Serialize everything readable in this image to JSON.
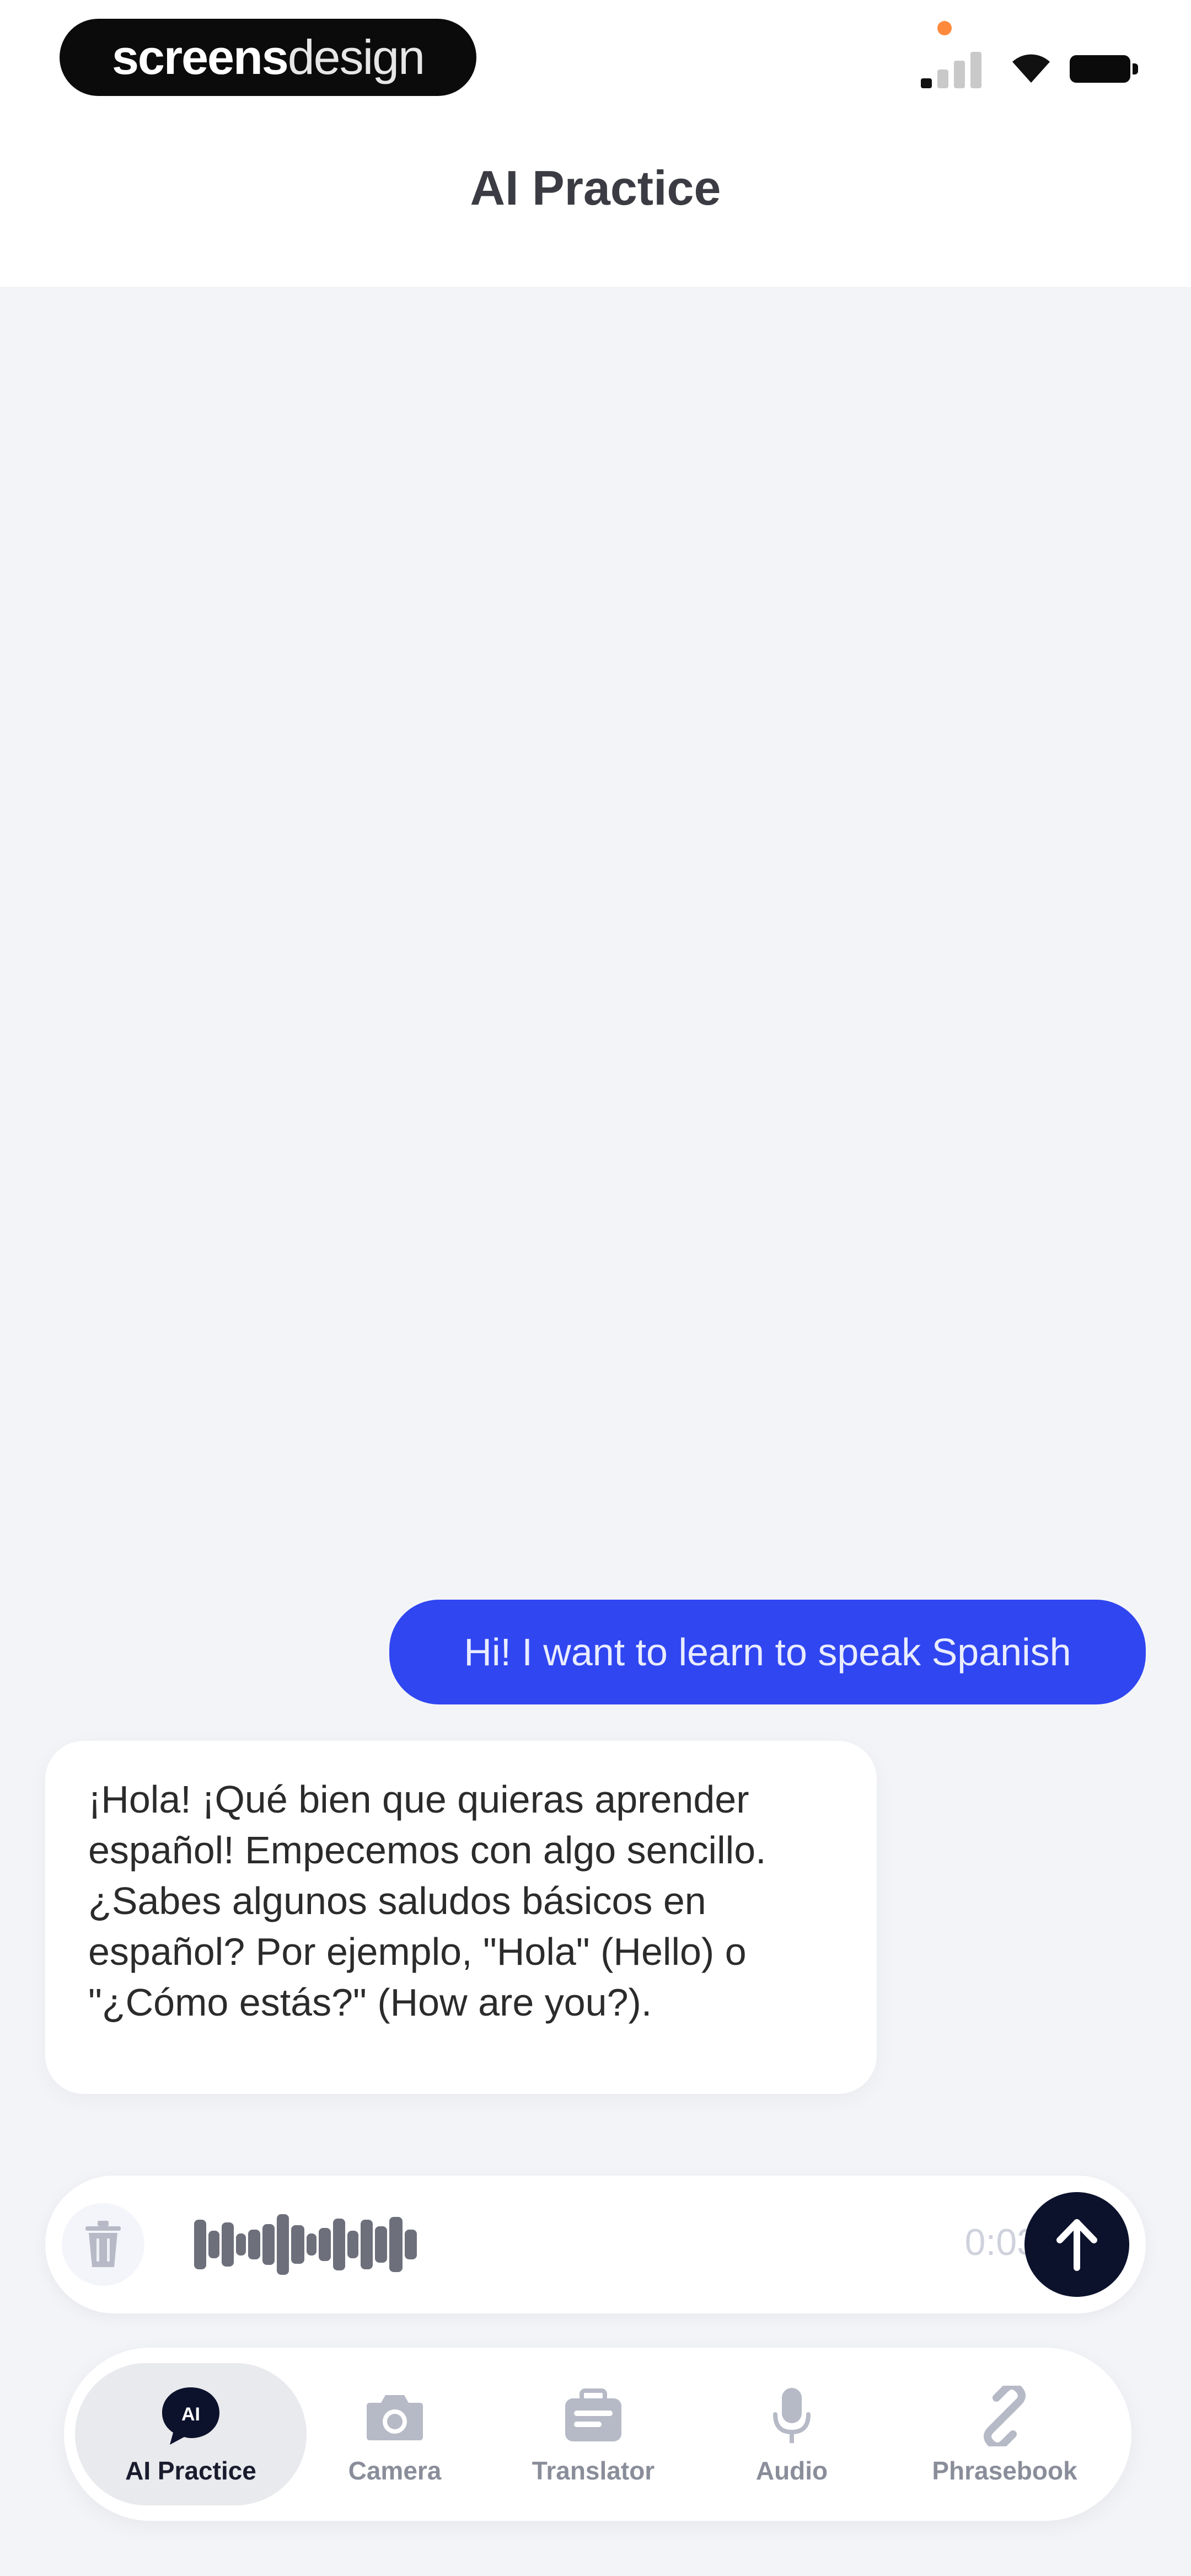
{
  "brand": {
    "part1": "screens",
    "part2": "design"
  },
  "header": {
    "title": "AI Practice"
  },
  "chat": {
    "messages": [
      {
        "sender": "user",
        "text": "Hi! I want to learn to speak Spanish"
      },
      {
        "sender": "assistant",
        "text": "¡Hola! ¡Qué bien que quieras aprender español! Empecemos con algo sencillo. ¿Sabes algunos saludos básicos en español? Por ejemplo, \"Hola\" (Hello) o \"¿Cómo estás?\" (How are you?)."
      }
    ]
  },
  "recorder": {
    "timer": "0:03",
    "icons": {
      "delete": "trash-icon",
      "send": "arrow-up-icon",
      "waveform": "waveform-icon"
    }
  },
  "tabs": [
    {
      "label": "AI Practice",
      "icon": "ai-chat-icon",
      "active": true
    },
    {
      "label": "Camera",
      "icon": "camera-icon",
      "active": false
    },
    {
      "label": "Translator",
      "icon": "translator-icon",
      "active": false
    },
    {
      "label": "Audio",
      "icon": "microphone-icon",
      "active": false
    },
    {
      "label": "Phrasebook",
      "icon": "link-icon",
      "active": false
    }
  ],
  "colors": {
    "background": "#f3f4f8",
    "user_bubble": "#3046f1",
    "send_button": "#0c122c",
    "camera_indicator": "#ff8a3d"
  }
}
